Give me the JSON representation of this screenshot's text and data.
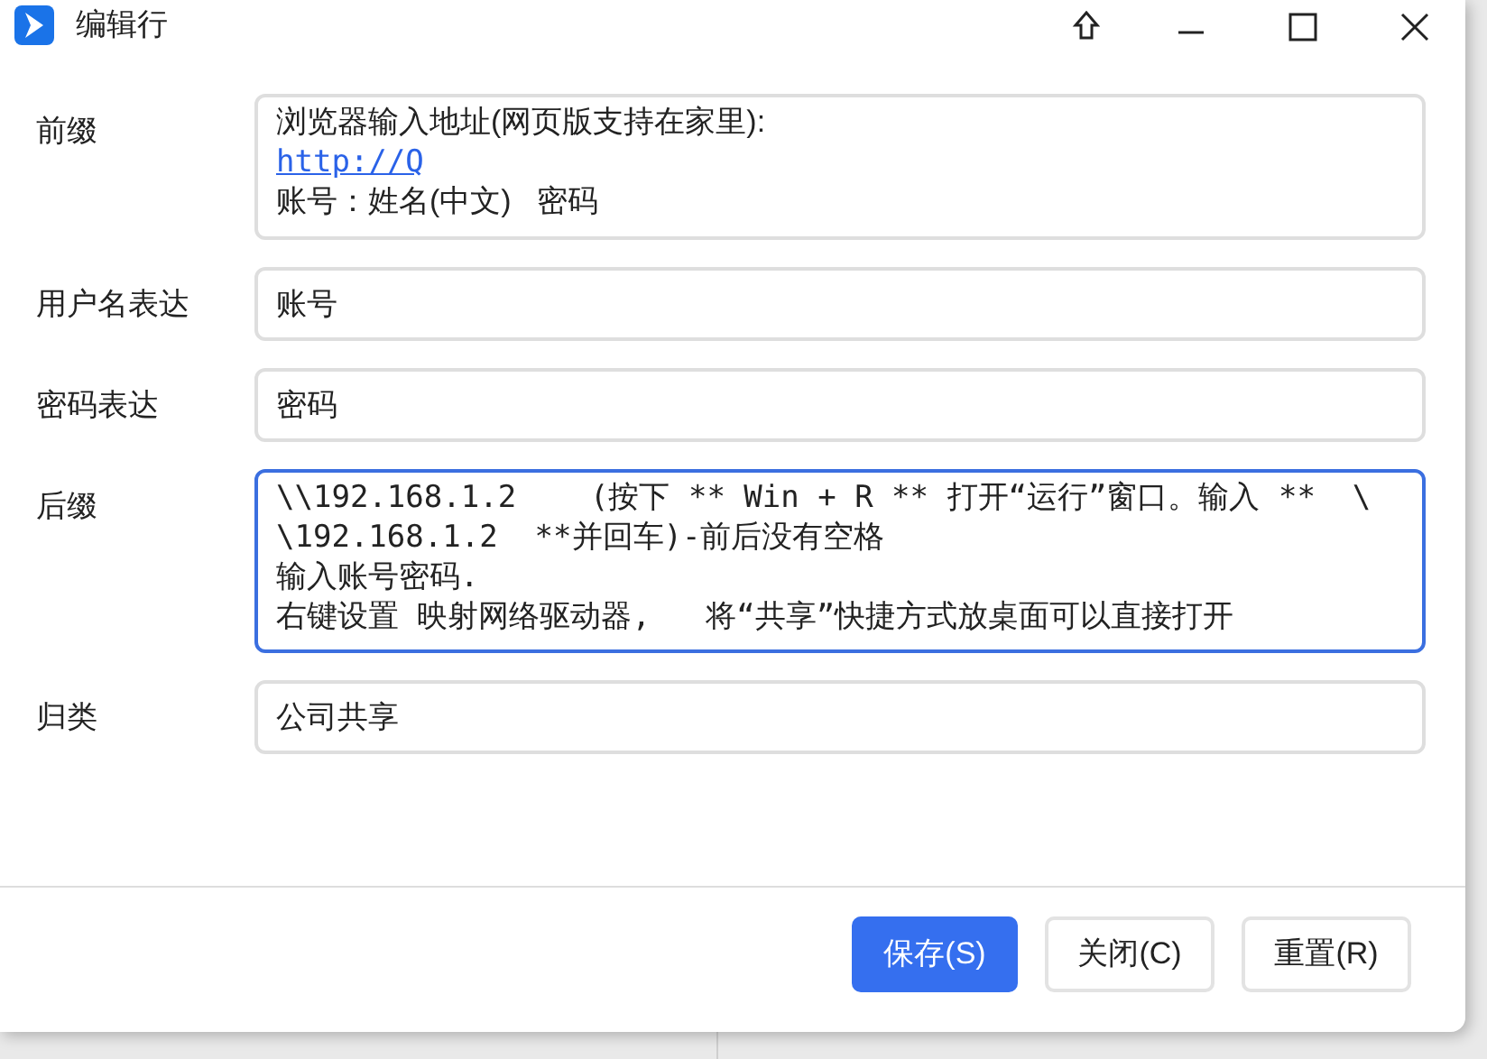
{
  "window": {
    "title": "编辑行"
  },
  "fields": [
    {
      "label": "前缀",
      "kind": "multiline",
      "focused": false,
      "lines": [
        {
          "kind": "text",
          "text": "浏览器输入地址(网页版支持在家里):"
        },
        {
          "kind": "link",
          "text": "http://Q"
        },
        {
          "kind": "text",
          "text": "账号：姓名(中文)   密码"
        }
      ]
    },
    {
      "label": "用户名表达",
      "kind": "single",
      "focused": false,
      "value": "账号"
    },
    {
      "label": "密码表达",
      "kind": "single",
      "focused": false,
      "value": "密码"
    },
    {
      "label": "后缀",
      "kind": "multiline",
      "focused": true,
      "lines": [
        {
          "kind": "text",
          "text": "\\\\192.168.1.2    (按下 ** Win + R ** 打开“运行”窗口。输入 **  \\"
        },
        {
          "kind": "text",
          "text": "\\192.168.1.2  **并回车)-前后没有空格"
        },
        {
          "kind": "text",
          "text": "输入账号密码."
        },
        {
          "kind": "text",
          "text": "右键设置 映射网络驱动器,   将“共享”快捷方式放桌面可以直接打开"
        }
      ]
    },
    {
      "label": "归类",
      "kind": "single",
      "focused": false,
      "value": "公司共享"
    }
  ],
  "buttons": [
    {
      "label": "保存(S)",
      "kind": "primary"
    },
    {
      "label": "关闭(C)",
      "kind": "default"
    },
    {
      "label": "重置(R)",
      "kind": "default"
    }
  ]
}
